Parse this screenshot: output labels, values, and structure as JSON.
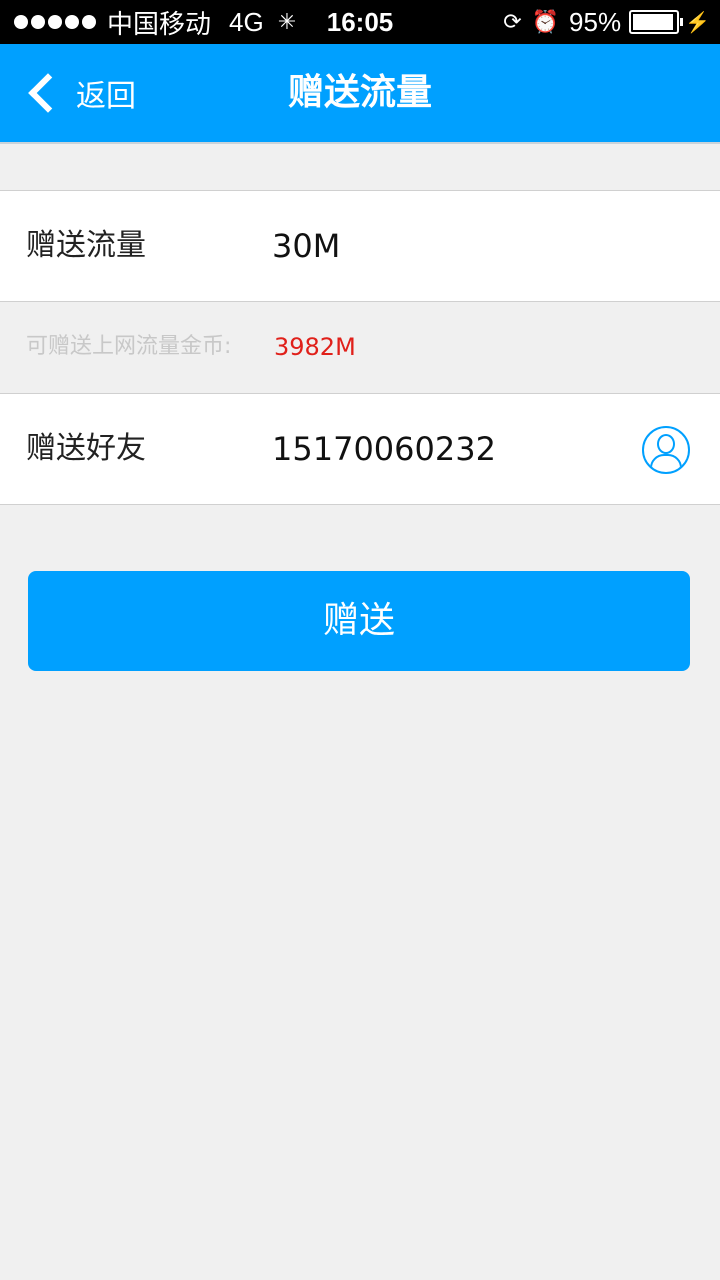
{
  "status_bar": {
    "carrier": "中国移动",
    "network": "4G",
    "time": "16:05",
    "battery_percent": "95%",
    "battery_level": 0.95,
    "signal_bars": 5,
    "icons": [
      "signal-dots-icon",
      "activity-spinner-icon",
      "rotation-lock-icon",
      "alarm-icon",
      "battery-icon",
      "charging-bolt-icon"
    ]
  },
  "nav": {
    "back_label": "返回",
    "title": "赠送流量"
  },
  "form": {
    "amount_label": "赠送流量",
    "amount_value": "30M",
    "balance_label": "可赠送上网流量金币:",
    "balance_value": "3982M",
    "friend_label": "赠送好友",
    "friend_value": "15170060232"
  },
  "actions": {
    "submit_label": "赠送"
  },
  "colors": {
    "accent": "#00a0ff",
    "background": "#f0f0f0",
    "highlight_red": "#e0201a",
    "hint_gray": "#c8c8c8"
  }
}
